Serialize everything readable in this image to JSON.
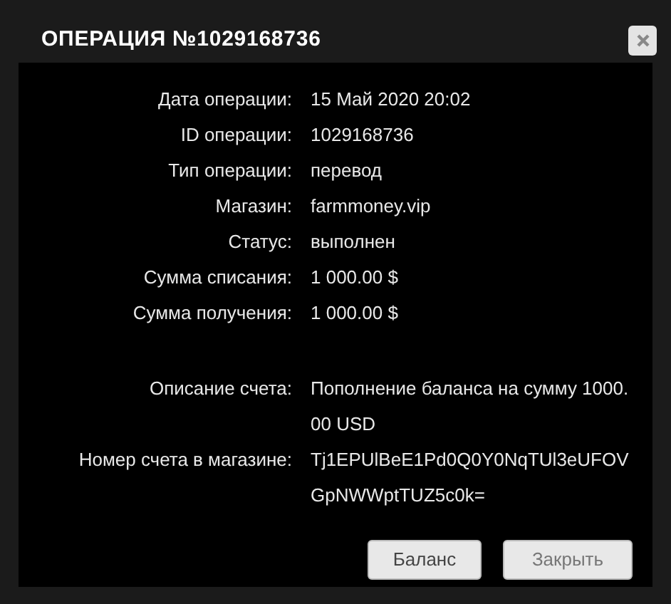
{
  "dialog": {
    "title": "ОПЕРАЦИЯ №1029168736",
    "details": [
      {
        "label": "Дата операции:",
        "value": "15 Май 2020 20:02"
      },
      {
        "label": "ID операции:",
        "value": "1029168736"
      },
      {
        "label": "Тип операции:",
        "value": "перевод"
      },
      {
        "label": "Магазин:",
        "value": "farmmoney.vip"
      },
      {
        "label": "Статус:",
        "value": "выполнен"
      },
      {
        "label": "Сумма списания:",
        "value": "1 000.00 $"
      },
      {
        "label": "Сумма получения:",
        "value": "1 000.00 $"
      }
    ],
    "invoice": [
      {
        "label": "Описание счета:",
        "value": "Пополнение баланса на сумму 1000.00 USD"
      },
      {
        "label": "Номер счета в магазине:",
        "value": "Tj1EPUlBeE1Pd0Q0Y0NqTUl3eUFOVGpNWWptTUZ5c0k="
      }
    ],
    "buttons": [
      "Баланс",
      "Закрыть"
    ]
  }
}
